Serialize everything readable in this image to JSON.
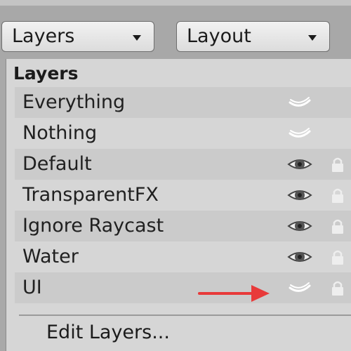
{
  "toolbar": {
    "layers_dropdown": "Layers",
    "layout_dropdown": "Layout"
  },
  "menu": {
    "header": "Layers",
    "items": [
      {
        "label": "Everything",
        "visible": "partial",
        "lock": false
      },
      {
        "label": "Nothing",
        "visible": "partial",
        "lock": false
      },
      {
        "label": "Default",
        "visible": true,
        "lock": true
      },
      {
        "label": "TransparentFX",
        "visible": true,
        "lock": true
      },
      {
        "label": "Ignore Raycast",
        "visible": true,
        "lock": true
      },
      {
        "label": "Water",
        "visible": true,
        "lock": true
      },
      {
        "label": "UI",
        "visible": false,
        "lock": true
      }
    ],
    "edit_layers": "Edit Layers..."
  },
  "colors": {
    "menu_bg": "#d6d6d6",
    "row_alt": "#cbcbcb",
    "arrow": "#e83a3a"
  },
  "icons": {
    "visible": "eye-icon",
    "hidden": "eye-closed-icon",
    "lock": "lock-icon",
    "caret": "chevron-down-icon"
  }
}
